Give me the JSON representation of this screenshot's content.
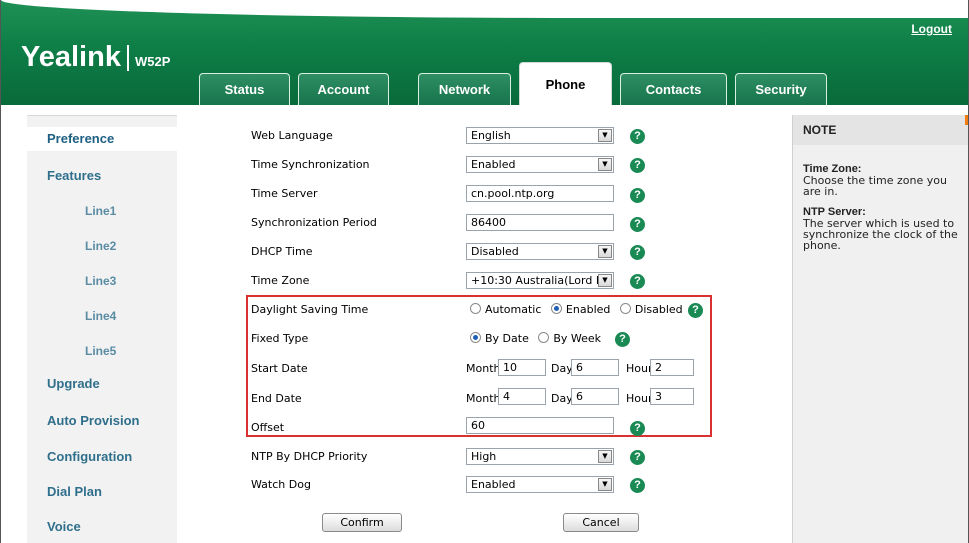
{
  "header": {
    "logout": "Logout",
    "logo": "Yealink",
    "model": "W52P",
    "tabs": [
      {
        "label": "Status",
        "active": false
      },
      {
        "label": "Account",
        "active": false
      },
      {
        "label": "Network",
        "active": false
      },
      {
        "label": "Phone",
        "active": true
      },
      {
        "label": "Contacts",
        "active": false
      },
      {
        "label": "Security",
        "active": false
      }
    ]
  },
  "nav": [
    {
      "label": "Preference",
      "active": true
    },
    {
      "label": "Features"
    },
    {
      "label": "Line1"
    },
    {
      "label": "Line2"
    },
    {
      "label": "Line3"
    },
    {
      "label": "Line4"
    },
    {
      "label": "Line5"
    },
    {
      "label": "Upgrade"
    },
    {
      "label": "Auto Provision"
    },
    {
      "label": "Configuration"
    },
    {
      "label": "Dial Plan"
    },
    {
      "label": "Voice"
    }
  ],
  "form": {
    "web_language": {
      "label": "Web Language",
      "value": "English"
    },
    "time_sync": {
      "label": "Time Synchronization",
      "value": "Enabled"
    },
    "time_server": {
      "label": "Time Server",
      "value": "cn.pool.ntp.org"
    },
    "sync_period": {
      "label": "Synchronization Period",
      "value": "86400"
    },
    "dhcp_time": {
      "label": "DHCP Time",
      "value": "Disabled"
    },
    "time_zone": {
      "label": "Time Zone",
      "value": "+10:30 Australia(Lord Hc"
    },
    "dst": {
      "label": "Daylight Saving Time",
      "options": [
        "Automatic",
        "Enabled",
        "Disabled"
      ],
      "selected": "Enabled"
    },
    "fixed_type": {
      "label": "Fixed Type",
      "options": [
        "By Date",
        "By Week"
      ],
      "selected": "By Date"
    },
    "start_date": {
      "label": "Start Date",
      "month_label": "Month",
      "month": "10",
      "day_label": "Day",
      "day": "6",
      "hour_label": "Hour",
      "hour": "2"
    },
    "end_date": {
      "label": "End Date",
      "month_label": "Month",
      "month": "4",
      "day_label": "Day",
      "day": "6",
      "hour_label": "Hour",
      "hour": "3"
    },
    "offset": {
      "label": "Offset",
      "value": "60"
    },
    "ntp_dhcp_priority": {
      "label": "NTP By DHCP Priority",
      "value": "High"
    },
    "watch_dog": {
      "label": "Watch Dog",
      "value": "Enabled"
    },
    "confirm": "Confirm",
    "cancel": "Cancel",
    "help_glyph": "?"
  },
  "note": {
    "heading": "NOTE",
    "time_zone_title": "Time Zone:",
    "time_zone_text": "Choose the time zone you are in.",
    "ntp_title": "NTP Server:",
    "ntp_text": "The server which is used to synchronize the clock of the phone."
  },
  "colors": {
    "brand_green": "#0e7e47",
    "nav_text": "#2f6f8c",
    "highlight": "#d93030",
    "accent": "#f07d12"
  }
}
